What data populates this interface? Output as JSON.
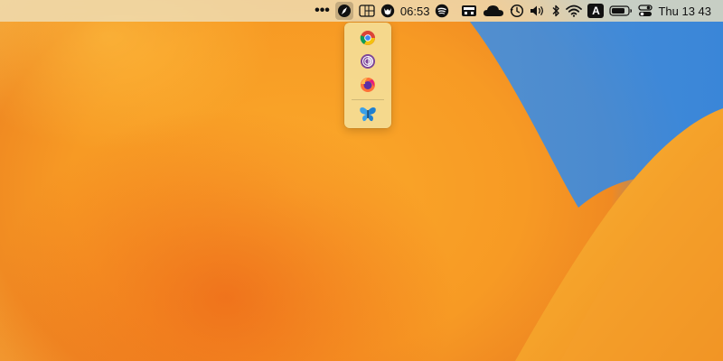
{
  "menubar": {
    "overflow_icon": "more-dots-icon",
    "clock": "06:53",
    "date_time": "Thu 13 43",
    "input_source": "A",
    "status_icons": [
      "safari-compass-icon",
      "grid-app-icon",
      "wolf-app-icon",
      "spotify-icon",
      "menu-app-icon",
      "cloud-icon",
      "time-machine-icon",
      "volume-icon",
      "bluetooth-icon",
      "wifi-icon",
      "keyboard-input-icon",
      "battery-icon",
      "control-center-icon"
    ]
  },
  "dropdown": {
    "items": [
      {
        "name": "chrome-icon",
        "color": "#4285f4"
      },
      {
        "name": "tor-browser-icon",
        "color": "#7d4698"
      },
      {
        "name": "firefox-icon",
        "color": "#ff7139"
      },
      {
        "name": "butterfly-app-icon",
        "color": "#3aa0e8"
      }
    ]
  },
  "colors": {
    "menubar_bg": "#eee1be",
    "dropdown_bg": "#f4dd96",
    "wallpaper_orange": "#f79a24",
    "wallpaper_blue": "#3b82d6"
  }
}
